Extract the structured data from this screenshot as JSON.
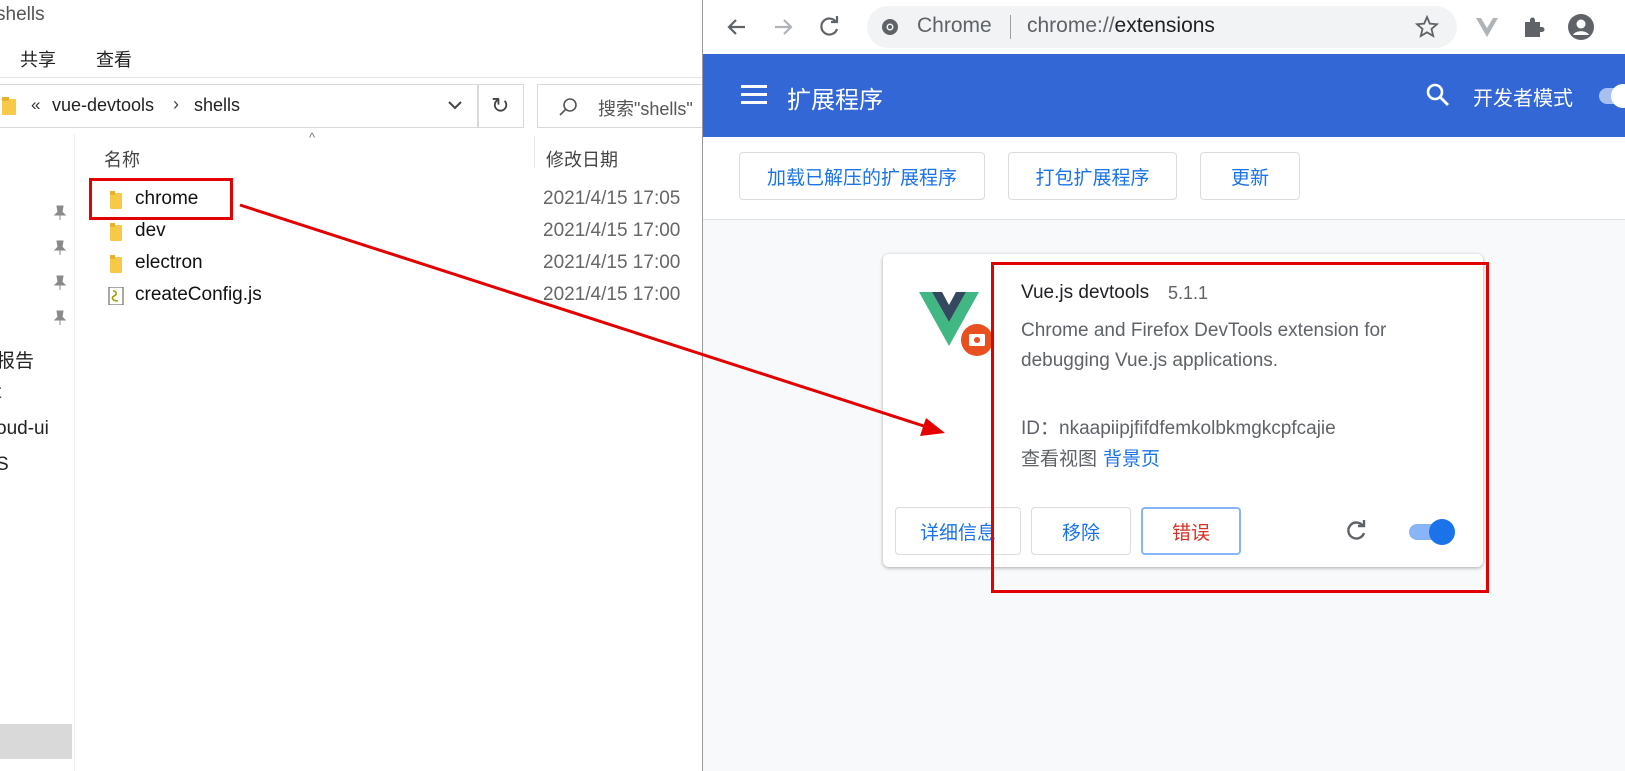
{
  "explorer": {
    "title": "shells",
    "menu": [
      "共享",
      "查看"
    ],
    "address": {
      "chevron": "«",
      "segments": [
        "vue-devtools",
        "shells"
      ],
      "separator": "›"
    },
    "search_placeholder": "搜索\"shells\"",
    "nav_items": [
      "报告",
      "t",
      "oud-ui",
      "S"
    ],
    "columns": {
      "name": "名称",
      "date": "修改日期"
    },
    "files": [
      {
        "name": "chrome",
        "date": "2021/4/15 17:05",
        "kind": "folder"
      },
      {
        "name": "dev",
        "date": "2021/4/15 17:00",
        "kind": "folder"
      },
      {
        "name": "electron",
        "date": "2021/4/15 17:00",
        "kind": "folder"
      },
      {
        "name": "createConfig.js",
        "date": "2021/4/15 17:00",
        "kind": "js-file"
      }
    ]
  },
  "chrome": {
    "omnibox": {
      "site": "Chrome",
      "url_prefix": "chrome://",
      "url_path": "extensions"
    },
    "header": {
      "title": "扩展程序",
      "dev_mode_label": "开发者模式",
      "dev_mode_on": true
    },
    "actions": [
      "加载已解压的扩展程序",
      "打包扩展程序",
      "更新"
    ],
    "extension": {
      "name": "Vue.js devtools",
      "version": "5.1.1",
      "description": "Chrome and Firefox DevTools extension for debugging Vue.js applications.",
      "id_label": "ID：",
      "id": "nkaapiipjfifdfemkolbkmgkcpfcajie",
      "views_label": "查看视图",
      "views_link": "背景页",
      "buttons": {
        "details": "详细信息",
        "remove": "移除",
        "errors": "错误"
      },
      "enabled": true
    },
    "colors": {
      "header": "#3367d6",
      "link": "#1a73e8",
      "error": "#d93025"
    }
  },
  "annotation": {
    "color": "#e30000"
  },
  "icons": [
    "back-icon",
    "forward-icon",
    "reload-icon",
    "globe-icon",
    "star-icon",
    "vue-extension-icon",
    "puzzle-icon",
    "profile-icon",
    "menu-icon",
    "search-icon",
    "folder-icon",
    "pin-icon",
    "vue-logo-icon",
    "error-badge-icon"
  ]
}
